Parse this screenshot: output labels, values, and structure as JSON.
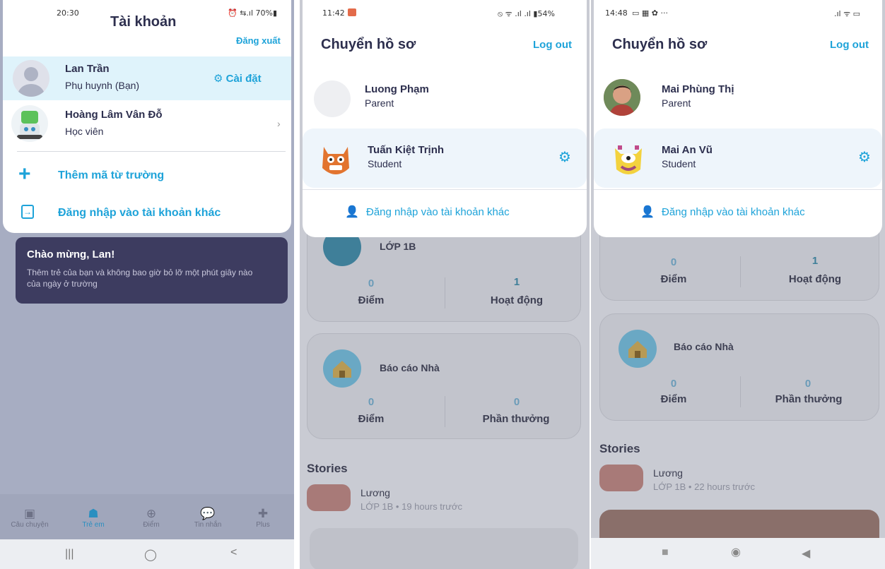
{
  "screen1": {
    "status_time": "20:30",
    "status_right": "⏰ ⇆.ıl 70%▮",
    "title": "Tài khoản",
    "logout_label": "Đăng xuất",
    "user": {
      "name": "Lan Trần",
      "role": "Phụ huynh (Bạn)",
      "settings_label": "Cài đặt"
    },
    "student": {
      "name": "Hoàng Lâm Vân Đỗ",
      "role": "Học viên"
    },
    "add_code_label": "Thêm mã từ trường",
    "login_other_label": "Đăng nhập vào tài khoản khác",
    "welcome": {
      "title": "Chào mừng, Lan!",
      "body": "Thêm trẻ của bạn và không bao giờ bỏ lỡ một phút giây nào của ngày ở trường"
    },
    "tabs": [
      {
        "label": "Câu chuyện",
        "icon": "image-icon"
      },
      {
        "label": "Trẻ em",
        "icon": "kid-icon"
      },
      {
        "label": "Điểm",
        "icon": "plus-circle-icon"
      },
      {
        "label": "Tin nhắn",
        "icon": "chat-icon"
      },
      {
        "label": "Plus",
        "icon": "sparkle-icon"
      }
    ],
    "sys_buttons": [
      "|||",
      "◯",
      "<"
    ]
  },
  "screen2": {
    "status_time": "11:42",
    "status_right": "⦸ ᯤ .ıl .ıl ▮54%",
    "title": "Chuyển hồ sơ",
    "logout_label": "Log out",
    "parent": {
      "name": "Luong Phạm",
      "role": "Parent"
    },
    "student": {
      "name": "Tuấn Kiệt Trịnh",
      "role": "Student"
    },
    "login_other_label": "Đăng nhập vào tài khoản khác",
    "class_card": {
      "name": "LỚP 1B",
      "points_value": "0",
      "points_label": "Điểm",
      "activity_value": "1",
      "activity_label": "Hoạt động"
    },
    "home_card": {
      "name": "Báo cáo Nhà",
      "points_value": "0",
      "points_label": "Điểm",
      "rewards_value": "0",
      "rewards_label": "Phần thưởng"
    },
    "stories_title": "Stories",
    "story": {
      "author": "Lương",
      "meta": "LỚP 1B • 19 hours trước"
    }
  },
  "screen3": {
    "status_time": "14:48",
    "status_right": ".ıl ᯤ ▭",
    "title": "Chuyển hồ sơ",
    "logout_label": "Log out",
    "parent": {
      "name": "Mai Phùng Thị",
      "role": "Parent"
    },
    "student": {
      "name": "Mai An Vũ",
      "role": "Student"
    },
    "login_other_label": "Đăng nhập vào tài khoản khác",
    "class_card": {
      "points_value": "0",
      "points_label": "Điểm",
      "activity_value": "1",
      "activity_label": "Hoạt động"
    },
    "home_card": {
      "name": "Báo cáo Nhà",
      "points_value": "0",
      "points_label": "Điểm",
      "rewards_value": "0",
      "rewards_label": "Phần thưởng"
    },
    "stories_title": "Stories",
    "story": {
      "author": "Lương",
      "meta": "LỚP 1B • 22 hours trước"
    },
    "sys_buttons": [
      "■",
      "◉",
      "◀"
    ]
  },
  "colors": {
    "accent": "#1ea3d9",
    "text": "#2d2f4e",
    "welcome_bg": "#3d3c60",
    "selected_row": "#dff3fb"
  }
}
